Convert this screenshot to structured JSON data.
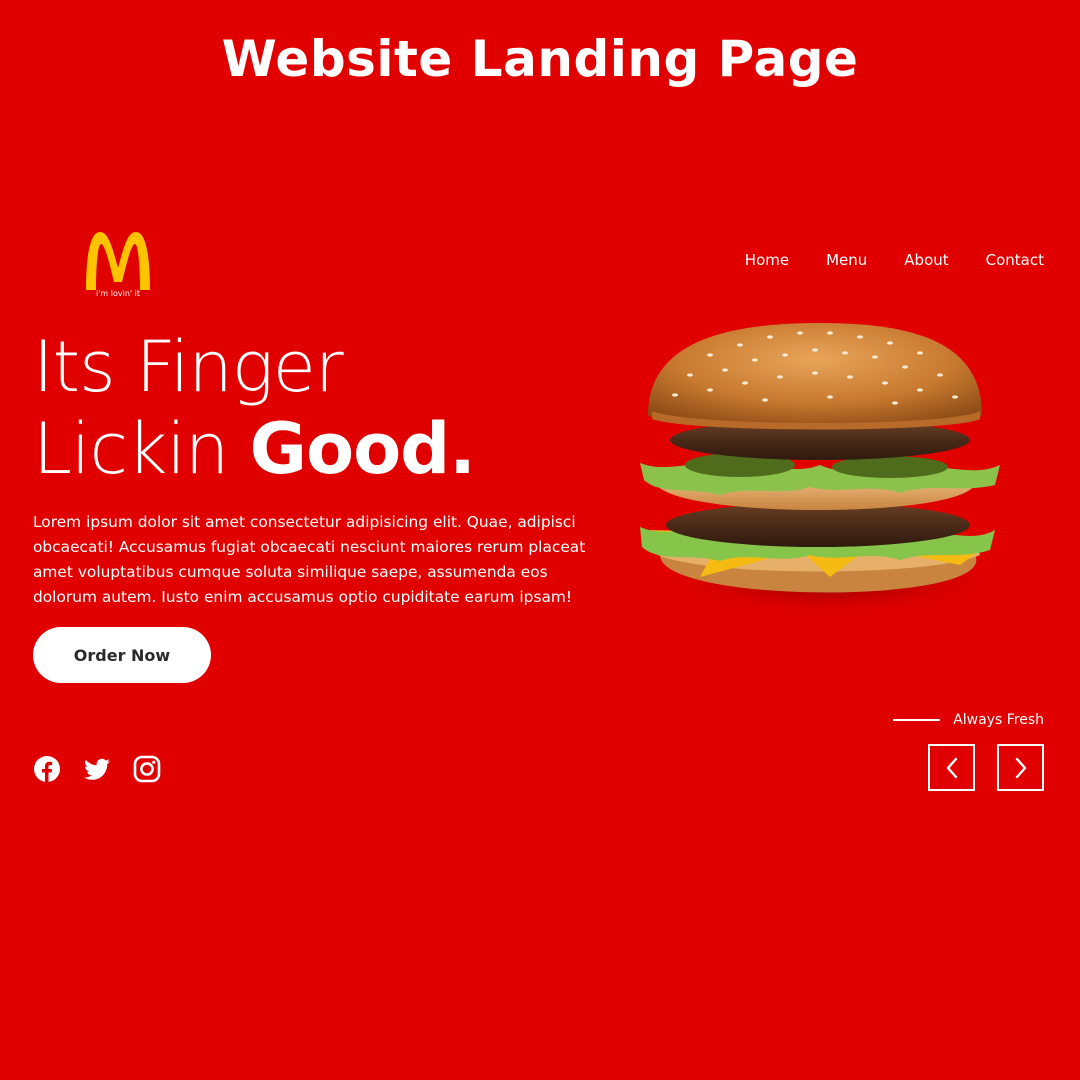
{
  "page": {
    "heading": "Website Landing Page"
  },
  "brand": {
    "logo_icon": "golden-arches-icon",
    "tagline": "i'm lovin' it",
    "arch_color": "#ffc300"
  },
  "nav": {
    "items": [
      "Home",
      "Menu",
      "About",
      "Contact"
    ]
  },
  "hero": {
    "title_line1": "Its Finger",
    "title_line2_light": "Lickin ",
    "title_line2_bold": "Good.",
    "body": "Lorem ipsum dolor sit amet consectetur adipisicing elit. Quae, adipisci obcaecati! Accusamus fugiat obcaecati nesciunt maiores rerum placeat amet voluptatibus cumque soluta similique saepe, assumenda eos dolorum autem. Iusto enim accusamus optio cupiditate earum ipsam!",
    "cta_label": "Order Now",
    "image_icon": "burger-image"
  },
  "socials": [
    "facebook-icon",
    "twitter-icon",
    "instagram-icon"
  ],
  "carousel": {
    "label": "Always Fresh",
    "prev_icon": "chevron-left-icon",
    "next_icon": "chevron-right-icon"
  },
  "colors": {
    "background": "#e10000",
    "text": "#ffffff",
    "button_text": "#2a2a2a"
  }
}
